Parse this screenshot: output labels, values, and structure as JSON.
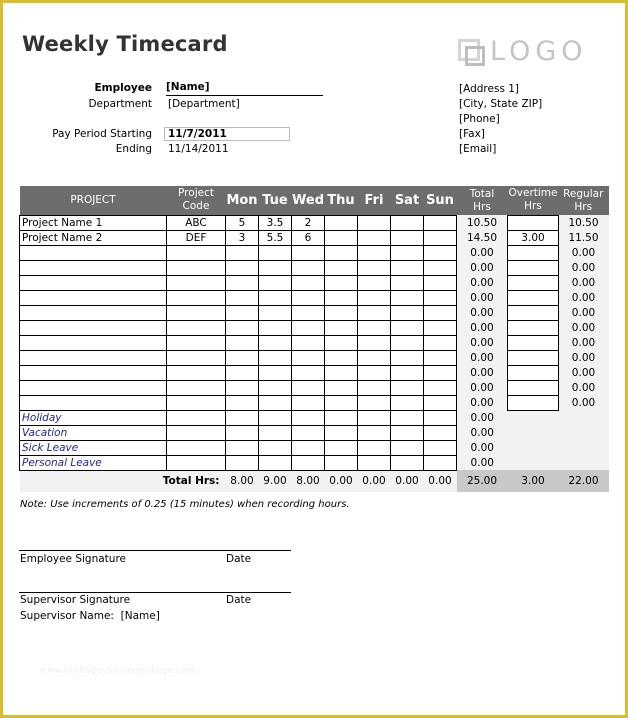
{
  "title": "Weekly Timecard",
  "logo": {
    "icon": "logo-squares-icon",
    "text": "LOGO"
  },
  "employee": {
    "employee_label": "Employee",
    "employee_value": "[Name]",
    "department_label": "Department",
    "department_value": "[Department]",
    "pay_period_label": "Pay Period Starting",
    "pay_period_value": "11/7/2011",
    "ending_label": "Ending",
    "ending_value": "11/14/2011"
  },
  "company": {
    "address1": "[Address 1]",
    "city_state_zip": "[City, State  ZIP]",
    "phone": "[Phone]",
    "fax": "[Fax]",
    "email": "[Email]"
  },
  "table": {
    "headers": {
      "project": "PROJECT",
      "code_line1": "Project",
      "code_line2": "Code",
      "days": [
        "Mon",
        "Tue",
        "Wed",
        "Thu",
        "Fri",
        "Sat",
        "Sun"
      ],
      "total_line1": "Total",
      "total_line2": "Hrs",
      "overtime_line1": "Overtime",
      "overtime_line2": "Hrs",
      "regular_line1": "Regular",
      "regular_line2": "Hrs"
    },
    "rows": [
      {
        "project": "Project Name 1",
        "code": "ABC",
        "days": [
          "5",
          "3.5",
          "2",
          "",
          "",
          "",
          ""
        ],
        "total": "10.50",
        "overtime": "",
        "regular": "10.50"
      },
      {
        "project": "Project Name 2",
        "code": "DEF",
        "days": [
          "3",
          "5.5",
          "6",
          "",
          "",
          "",
          ""
        ],
        "total": "14.50",
        "overtime": "3.00",
        "regular": "11.50"
      },
      {
        "project": "",
        "code": "",
        "days": [
          "",
          "",
          "",
          "",
          "",
          "",
          ""
        ],
        "total": "0.00",
        "overtime": "",
        "regular": "0.00"
      },
      {
        "project": "",
        "code": "",
        "days": [
          "",
          "",
          "",
          "",
          "",
          "",
          ""
        ],
        "total": "0.00",
        "overtime": "",
        "regular": "0.00"
      },
      {
        "project": "",
        "code": "",
        "days": [
          "",
          "",
          "",
          "",
          "",
          "",
          ""
        ],
        "total": "0.00",
        "overtime": "",
        "regular": "0.00"
      },
      {
        "project": "",
        "code": "",
        "days": [
          "",
          "",
          "",
          "",
          "",
          "",
          ""
        ],
        "total": "0.00",
        "overtime": "",
        "regular": "0.00"
      },
      {
        "project": "",
        "code": "",
        "days": [
          "",
          "",
          "",
          "",
          "",
          "",
          ""
        ],
        "total": "0.00",
        "overtime": "",
        "regular": "0.00"
      },
      {
        "project": "",
        "code": "",
        "days": [
          "",
          "",
          "",
          "",
          "",
          "",
          ""
        ],
        "total": "0.00",
        "overtime": "",
        "regular": "0.00"
      },
      {
        "project": "",
        "code": "",
        "days": [
          "",
          "",
          "",
          "",
          "",
          "",
          ""
        ],
        "total": "0.00",
        "overtime": "",
        "regular": "0.00"
      },
      {
        "project": "",
        "code": "",
        "days": [
          "",
          "",
          "",
          "",
          "",
          "",
          ""
        ],
        "total": "0.00",
        "overtime": "",
        "regular": "0.00"
      },
      {
        "project": "",
        "code": "",
        "days": [
          "",
          "",
          "",
          "",
          "",
          "",
          ""
        ],
        "total": "0.00",
        "overtime": "",
        "regular": "0.00"
      },
      {
        "project": "",
        "code": "",
        "days": [
          "",
          "",
          "",
          "",
          "",
          "",
          ""
        ],
        "total": "0.00",
        "overtime": "",
        "regular": "0.00"
      },
      {
        "project": "",
        "code": "",
        "days": [
          "",
          "",
          "",
          "",
          "",
          "",
          ""
        ],
        "total": "0.00",
        "overtime": "",
        "regular": "0.00"
      }
    ],
    "leave_rows": [
      {
        "project": "Holiday",
        "code": "",
        "days": [
          "",
          "",
          "",
          "",
          "",
          "",
          ""
        ],
        "total": "0.00"
      },
      {
        "project": "Vacation",
        "code": "",
        "days": [
          "",
          "",
          "",
          "",
          "",
          "",
          ""
        ],
        "total": "0.00"
      },
      {
        "project": "Sick Leave",
        "code": "",
        "days": [
          "",
          "",
          "",
          "",
          "",
          "",
          ""
        ],
        "total": "0.00"
      },
      {
        "project": "Personal Leave",
        "code": "",
        "days": [
          "",
          "",
          "",
          "",
          "",
          "",
          ""
        ],
        "total": "0.00"
      }
    ],
    "totals": {
      "label": "Total Hrs:",
      "days": [
        "8.00",
        "9.00",
        "8.00",
        "0.00",
        "0.00",
        "0.00",
        "0.00"
      ],
      "total": "25.00",
      "overtime": "3.00",
      "regular": "22.00"
    }
  },
  "note": "Note: Use increments of 0.25 (15 minutes) when recording hours.",
  "signatures": {
    "employee_signature": "Employee Signature",
    "employee_date": "Date",
    "supervisor_signature": "Supervisor Signature",
    "supervisor_date": "Date",
    "supervisor_name_label": "Supervisor Name:",
    "supervisor_name_value": "[Name]"
  },
  "watermark": "www.heritagechristiancollege.com"
}
